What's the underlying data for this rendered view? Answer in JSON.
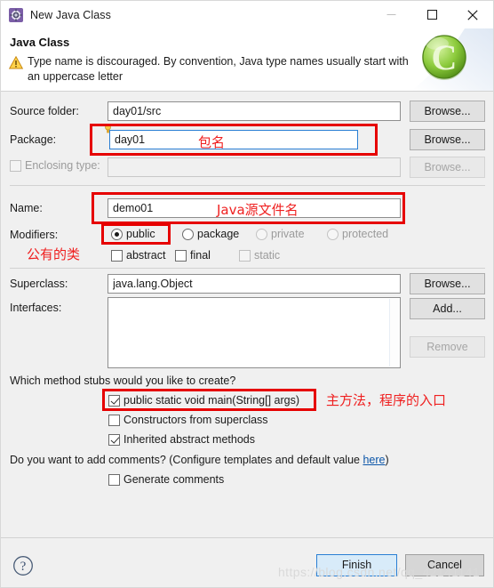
{
  "window": {
    "title": "New Java Class",
    "icon": "java-class-wizard-icon",
    "buttons": {
      "minimize": "minimize-icon",
      "maximize": "maximize-icon",
      "close": "close-icon"
    }
  },
  "header": {
    "title": "Java Class",
    "message": "Type name is discouraged. By convention, Java type names usually start with an uppercase letter",
    "icon": "warning-icon",
    "banner_icon": "java-class-banner-icon"
  },
  "form": {
    "source_folder": {
      "label": "Source folder:",
      "value": "day01/src",
      "browse": "Browse..."
    },
    "package": {
      "label": "Package:",
      "value": "day01",
      "browse": "Browse..."
    },
    "enclosing_type": {
      "label": "Enclosing type:",
      "value": "",
      "checked": false,
      "browse": "Browse..."
    },
    "name": {
      "label": "Name:",
      "value": "demo01"
    },
    "modifiers": {
      "label": "Modifiers:",
      "access": [
        {
          "label": "public",
          "checked": true,
          "enabled": true
        },
        {
          "label": "package",
          "checked": false,
          "enabled": true
        },
        {
          "label": "private",
          "checked": false,
          "enabled": false
        },
        {
          "label": "protected",
          "checked": false,
          "enabled": false
        }
      ],
      "flags": [
        {
          "label": "abstract",
          "checked": false,
          "enabled": true
        },
        {
          "label": "final",
          "checked": false,
          "enabled": true
        },
        {
          "label": "static",
          "checked": false,
          "enabled": false
        }
      ]
    },
    "superclass": {
      "label": "Superclass:",
      "value": "java.lang.Object",
      "browse": "Browse..."
    },
    "interfaces": {
      "label": "Interfaces:",
      "items": [],
      "add": "Add...",
      "remove": "Remove"
    }
  },
  "stubs": {
    "question": "Which method stubs would you like to create?",
    "options": [
      {
        "label": "public static void main(String[] args)",
        "checked": true
      },
      {
        "label": "Constructors from superclass",
        "checked": false
      },
      {
        "label": "Inherited abstract methods",
        "checked": true
      }
    ]
  },
  "comments": {
    "prefix": "Do you want to add comments? (Configure templates and default value ",
    "link": "here",
    "suffix": ")",
    "generate": {
      "label": "Generate comments",
      "checked": false
    }
  },
  "footer": {
    "help": "help-icon",
    "finish": "Finish",
    "cancel": "Cancel"
  },
  "annotations": {
    "package_note": "包名",
    "name_note": "Java源文件名",
    "public_note": "公有的类",
    "main_note": "主方法，程序的入口",
    "color": "#e60000"
  },
  "watermark": "https://blog.csdn.net/qq_42141141"
}
